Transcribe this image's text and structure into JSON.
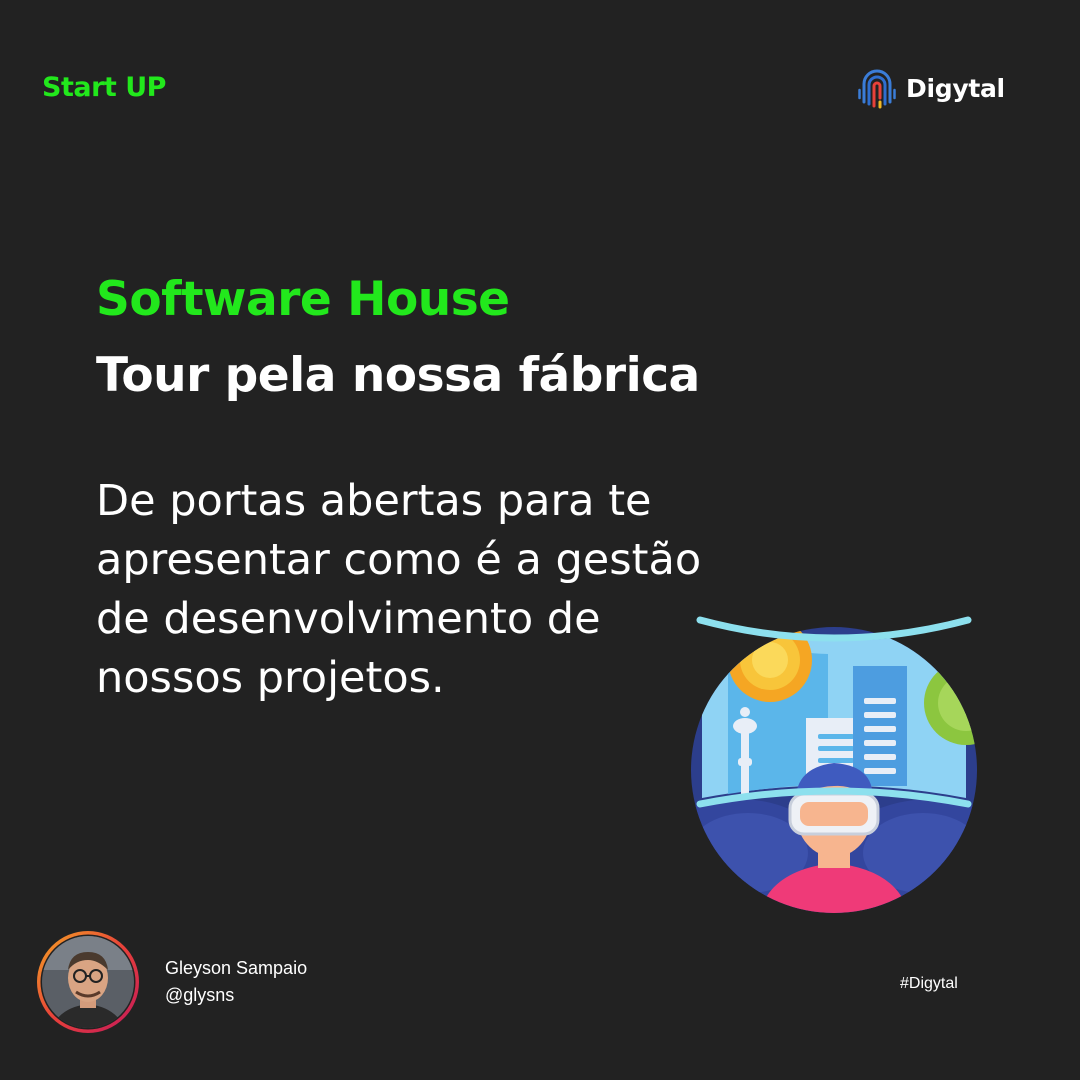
{
  "header": {
    "tag": "Start UP",
    "brand_name": "Digytal",
    "brand_icon": "fingerprint-icon"
  },
  "main": {
    "headline": "Software House",
    "subheadline": "Tour pela nossa fábrica",
    "body_lines": [
      "De portas abertas para te",
      "apresentar como é a gestão",
      "de desenvolvimento de",
      "nossos projetos."
    ],
    "illustration_icon": "virtual-reality-icon"
  },
  "footer": {
    "author_name": "Gleyson Sampaio",
    "author_handle": "@glysns",
    "hashtag": "#Digytal"
  },
  "colors": {
    "background": "#222222",
    "accent": "#22e81c",
    "text": "#ffffff"
  }
}
